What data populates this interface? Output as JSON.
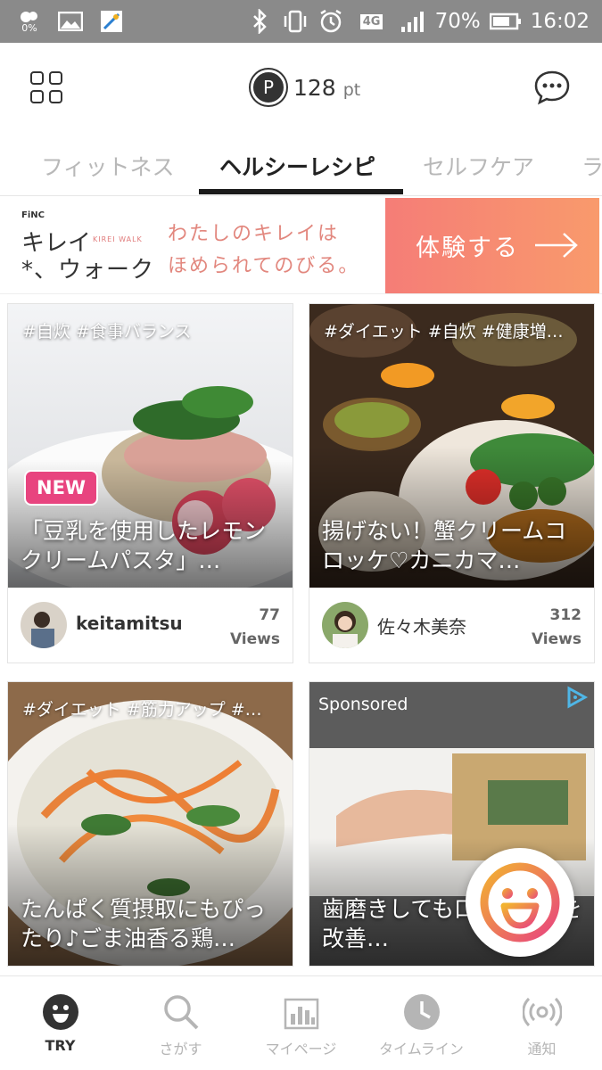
{
  "status_bar": {
    "data_saver": "0%",
    "network": "4G",
    "battery": "70%",
    "time": "16:02"
  },
  "header": {
    "points_icon_letter": "P",
    "points_value": "128",
    "points_unit": "pt"
  },
  "tabs": [
    {
      "label": "フィットネス",
      "active": false
    },
    {
      "label": "ヘルシーレシピ",
      "active": true
    },
    {
      "label": "セルフケア",
      "active": false
    },
    {
      "label": "ラ",
      "active": false
    }
  ],
  "banner": {
    "brand_small": "FiNC",
    "brand_line1": "キレイ",
    "brand_line2": "*、ウォーク",
    "brand_en": "KIREI WALK",
    "tagline1": "わたしのキレイは",
    "tagline2": "ほめられてのびる。",
    "cta": "体験する"
  },
  "cards": [
    {
      "tags": "#自炊 #食事バランス",
      "badge": "NEW",
      "title": "「豆乳を使用したレモンクリームパスタ」…",
      "author": "keitamitsu",
      "views_count": "77",
      "views_label": "Views"
    },
    {
      "tags": "#ダイエット #自炊 #健康増…",
      "title": "揚げない！蟹クリームコロッケ♡カニカマ…",
      "author": "佐々木美奈",
      "views_count": "312",
      "views_label": "Views"
    },
    {
      "tags": "#ダイエット #筋力アップ #…",
      "title": "たんぱく質摂取にもぴったり♪ごま油香る鶏…"
    },
    {
      "sponsored": "Sponsored",
      "title": "歯磨きしても口臭は●●を改善…"
    }
  ],
  "bottom_nav": [
    {
      "label": "TRY",
      "icon": "smile-icon",
      "active": true
    },
    {
      "label": "さがす",
      "icon": "search-icon",
      "active": false
    },
    {
      "label": "マイページ",
      "icon": "bar-chart-icon",
      "active": false
    },
    {
      "label": "タイムライン",
      "icon": "clock-icon",
      "active": false
    },
    {
      "label": "通知",
      "icon": "broadcast-icon",
      "active": false
    }
  ],
  "colors": {
    "accent_pink": "#e8447f",
    "banner_orange": "#f88a70",
    "fab_gradient_start": "#f2b330",
    "fab_gradient_end": "#e8447f"
  }
}
